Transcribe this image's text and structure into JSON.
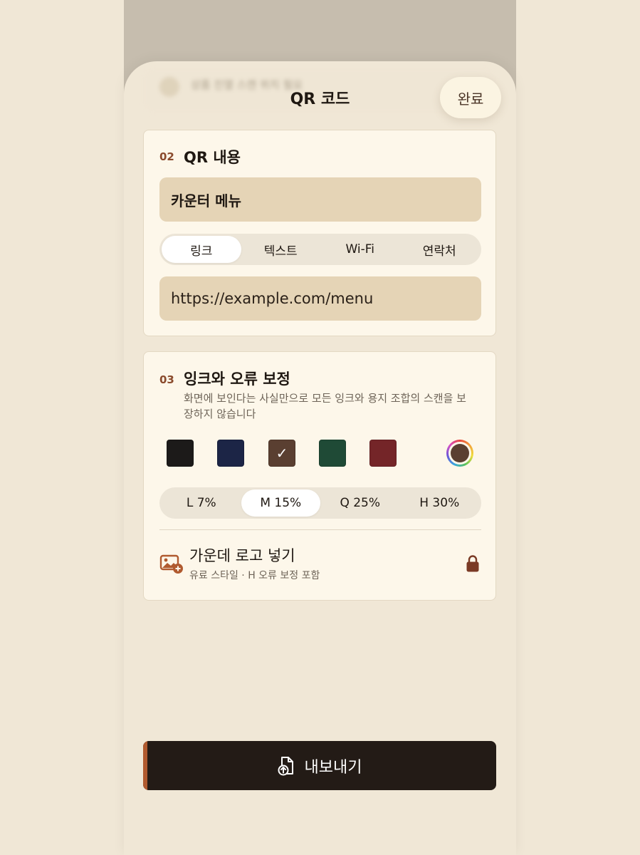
{
  "backdrop": {
    "blurred_text": "상품 진열 스캔 위치 필요"
  },
  "header": {
    "title": "QR 코드",
    "done_label": "완료"
  },
  "content_section": {
    "number": "02",
    "title": "QR 내용",
    "name_value": "카운터 메뉴",
    "type_tabs": [
      "링크",
      "텍스트",
      "Wi-Fi",
      "연락처"
    ],
    "selected_type": "링크",
    "url_value": "https://example.com/menu"
  },
  "ink_section": {
    "number": "03",
    "title": "잉크와 오류 보정",
    "description": "화면에 보인다는 사실만으로 모든 잉크와 용지 조합의 스캔을 보장하지 않습니다",
    "swatches": [
      {
        "name": "black",
        "color": "#1c1a19",
        "selected": false
      },
      {
        "name": "navy",
        "color": "#1c2546",
        "selected": false
      },
      {
        "name": "brown",
        "color": "#5a3f31",
        "selected": true
      },
      {
        "name": "green",
        "color": "#1f4a36",
        "selected": false
      },
      {
        "name": "red",
        "color": "#742528",
        "selected": false
      }
    ],
    "custom_color": "#5a3f31",
    "check_glyph": "✓",
    "correction_levels": [
      "L 7%",
      "M 15%",
      "Q 25%",
      "H 30%"
    ],
    "selected_level": "M 15%",
    "logo_option": {
      "title": "가운데 로고 넣기",
      "subtitle": "유료 스타일 · H 오류 보정 포함",
      "icon": "image-add-icon",
      "locked": true
    }
  },
  "export": {
    "label": "내보내기",
    "icon": "file-export-icon"
  },
  "colors": {
    "accent": "#8a4a2c",
    "field_bg": "#e5d4b6",
    "card_bg": "#fdf7ea",
    "page_bg": "#f0e7d6",
    "export_bg": "#231b16"
  }
}
